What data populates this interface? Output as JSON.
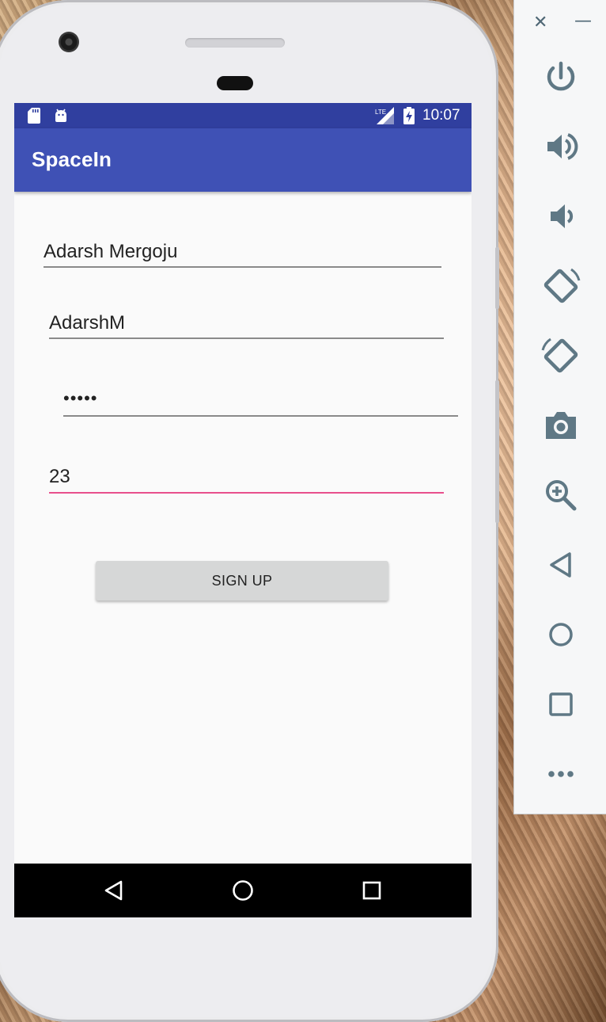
{
  "status_bar": {
    "time": "10:07",
    "network": "LTE"
  },
  "app_bar": {
    "title": "SpaceIn"
  },
  "form": {
    "name_value": "Adarsh Mergoju",
    "username_value": "AdarshM",
    "password_value": "•••••",
    "age_value": "23",
    "signup_label": "SIGN UP"
  },
  "colors": {
    "status_bar": "#303f9f",
    "app_bar": "#3f51b5",
    "focus_underline": "#e84f8c",
    "toolbar_icon": "#5f7885"
  },
  "emulator_toolbar": {
    "icons": [
      "close-icon",
      "minimize-icon",
      "power-icon",
      "volume-up-icon",
      "volume-down-icon",
      "rotate-left-icon",
      "rotate-right-icon",
      "camera-icon",
      "zoom-icon",
      "back-icon",
      "home-icon",
      "overview-icon",
      "more-icon"
    ]
  }
}
